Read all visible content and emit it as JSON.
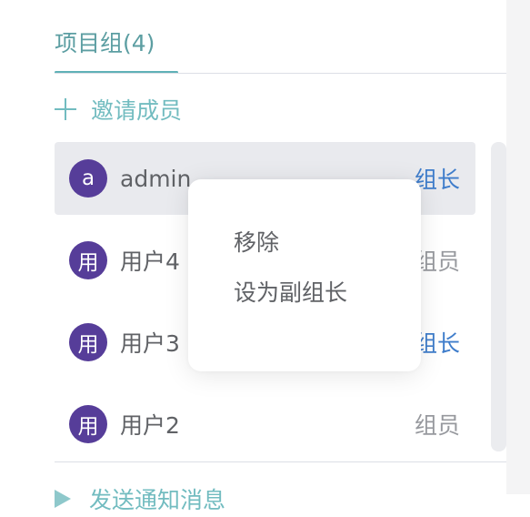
{
  "tab": {
    "label": "项目组(4)"
  },
  "invite": {
    "label": "邀请成员"
  },
  "members": [
    {
      "avatar": "a",
      "name": "admin",
      "role": "组长"
    },
    {
      "avatar": "用",
      "name": "用户4",
      "role": "组员"
    },
    {
      "avatar": "用",
      "name": "用户3",
      "role": "组长"
    },
    {
      "avatar": "用",
      "name": "用户2",
      "role": "组员"
    }
  ],
  "send_notify": {
    "label": "发送通知消息"
  },
  "context_menu": {
    "items": [
      "移除",
      "设为副组长"
    ]
  },
  "colors": {
    "accent": "#5fb1b7",
    "avatar_bg": "#563d99",
    "leader_role": "#3f7dcb",
    "member_role": "#97999e"
  }
}
